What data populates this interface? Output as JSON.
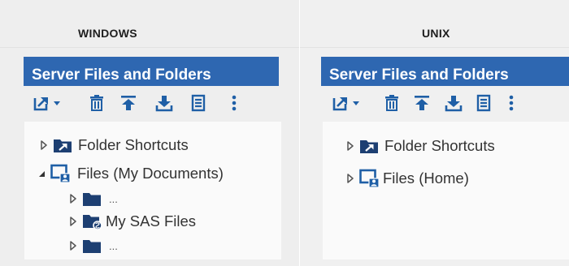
{
  "windows": {
    "os_label": "WINDOWS",
    "header": "Server Files and Folders",
    "toolbar": [
      "new-item-icon",
      "chevron-down-icon",
      "trash-icon",
      "upload-icon",
      "download-icon",
      "properties-icon",
      "more-icon"
    ],
    "tree": [
      {
        "label": "Folder Shortcuts",
        "arrow": "collapsed",
        "icon": "folder-shortcut-icon"
      },
      {
        "label": "Files (My Documents)",
        "arrow": "expanded",
        "icon": "home-folder-icon"
      },
      {
        "label": "...",
        "arrow": "collapsed",
        "icon": "folder-icon"
      },
      {
        "label": "My SAS Files",
        "arrow": "collapsed",
        "icon": "sas-folder-icon"
      },
      {
        "label": "...",
        "arrow": "collapsed",
        "icon": "folder-icon"
      }
    ]
  },
  "unix": {
    "os_label": "UNIX",
    "header": "Server Files and Folders",
    "toolbar": [
      "new-item-icon",
      "chevron-down-icon",
      "trash-icon",
      "upload-icon",
      "download-icon",
      "properties-icon",
      "more-icon"
    ],
    "tree": [
      {
        "label": "Folder Shortcuts",
        "arrow": "collapsed",
        "icon": "folder-shortcut-icon"
      },
      {
        "label": "Files (Home)",
        "arrow": "collapsed",
        "icon": "home-folder-icon"
      }
    ]
  },
  "colors": {
    "header_bg": "#2e67b1",
    "icon_blue": "#1f5fa6",
    "folder_navy": "#1d3f72"
  }
}
